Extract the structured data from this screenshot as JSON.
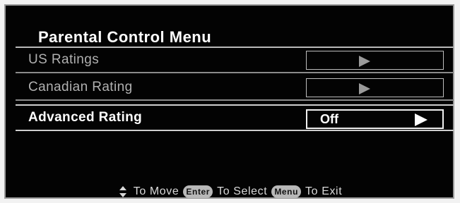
{
  "menu": {
    "title": "Parental Control Menu",
    "items": [
      {
        "label": "US Ratings",
        "value": "",
        "state": "disabled"
      },
      {
        "label": "Canadian Rating",
        "value": "",
        "state": "disabled"
      },
      {
        "label": "Advanced Rating",
        "value": "Off",
        "state": "selected"
      }
    ]
  },
  "footer": {
    "move_text": "To Move",
    "enter_key": "Enter",
    "select_text": "To Select",
    "menu_key": "Menu",
    "exit_text": "To Exit",
    "updown_icon": "up-down-arrows-icon"
  },
  "colors": {
    "background": "#030303",
    "border": "#9a9a9a",
    "text_active": "#ffffff",
    "text_disabled": "#b0b0b0"
  }
}
